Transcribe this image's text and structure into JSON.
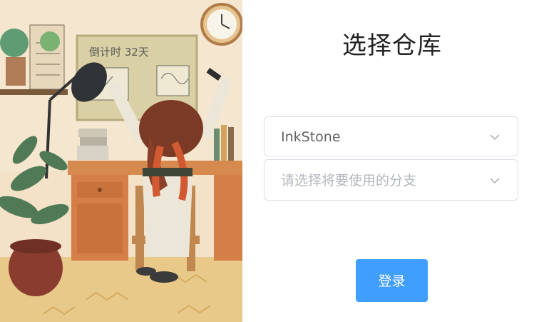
{
  "illustration": {
    "icon": "study-desk-illustration",
    "board_text": "倒计时  32天"
  },
  "form": {
    "title": "选择仓库",
    "repo_select": {
      "value": "InkStone",
      "icon": "chevron-down-icon"
    },
    "branch_select": {
      "placeholder": "请选择将要使用的分支",
      "icon": "chevron-down-icon"
    },
    "login_label": "登录"
  },
  "colors": {
    "primary": "#409eff",
    "border": "#dcdfe6",
    "placeholder": "#b4b7be"
  }
}
